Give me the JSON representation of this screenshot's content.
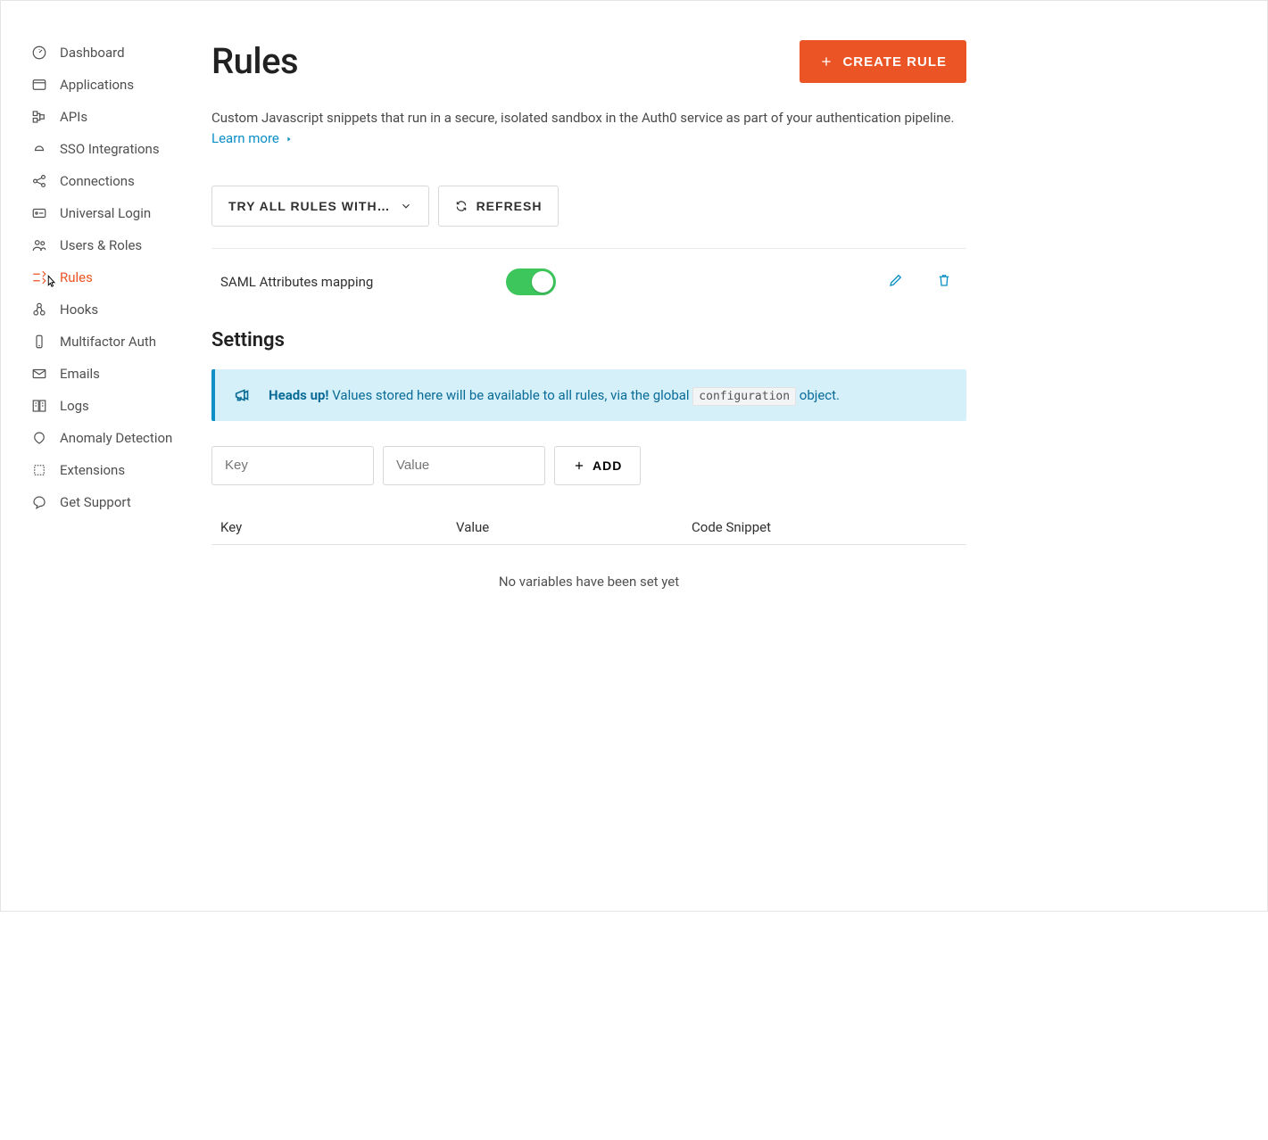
{
  "sidebar": {
    "items": [
      {
        "label": "Dashboard",
        "icon": "dashboard-icon"
      },
      {
        "label": "Applications",
        "icon": "applications-icon"
      },
      {
        "label": "APIs",
        "icon": "apis-icon"
      },
      {
        "label": "SSO Integrations",
        "icon": "sso-icon"
      },
      {
        "label": "Connections",
        "icon": "connections-icon"
      },
      {
        "label": "Universal Login",
        "icon": "login-icon"
      },
      {
        "label": "Users & Roles",
        "icon": "users-icon"
      },
      {
        "label": "Rules",
        "icon": "rules-icon",
        "active": true
      },
      {
        "label": "Hooks",
        "icon": "hooks-icon"
      },
      {
        "label": "Multifactor Auth",
        "icon": "mfa-icon"
      },
      {
        "label": "Emails",
        "icon": "emails-icon"
      },
      {
        "label": "Logs",
        "icon": "logs-icon"
      },
      {
        "label": "Anomaly Detection",
        "icon": "anomaly-icon"
      },
      {
        "label": "Extensions",
        "icon": "extensions-icon"
      },
      {
        "label": "Get Support",
        "icon": "support-icon"
      }
    ]
  },
  "header": {
    "title": "Rules",
    "create_label": "CREATE RULE",
    "description": "Custom Javascript snippets that run in a secure, isolated sandbox in the Auth0 service as part of your authentication pipeline.",
    "learn_more": "Learn more"
  },
  "toolbar": {
    "try_label": "TRY ALL RULES WITH…",
    "refresh_label": "REFRESH"
  },
  "rules": [
    {
      "name": "SAML Attributes mapping",
      "enabled": true
    }
  ],
  "settings": {
    "title": "Settings",
    "alert_bold": "Heads up!",
    "alert_text_pre": " Values stored here will be available to all rules, via the global ",
    "alert_code": "configuration",
    "alert_text_post": " object.",
    "key_placeholder": "Key",
    "value_placeholder": "Value",
    "add_label": "ADD",
    "table_headers": {
      "key": "Key",
      "value": "Value",
      "snippet": "Code Snippet"
    },
    "empty_message": "No variables have been set yet"
  }
}
